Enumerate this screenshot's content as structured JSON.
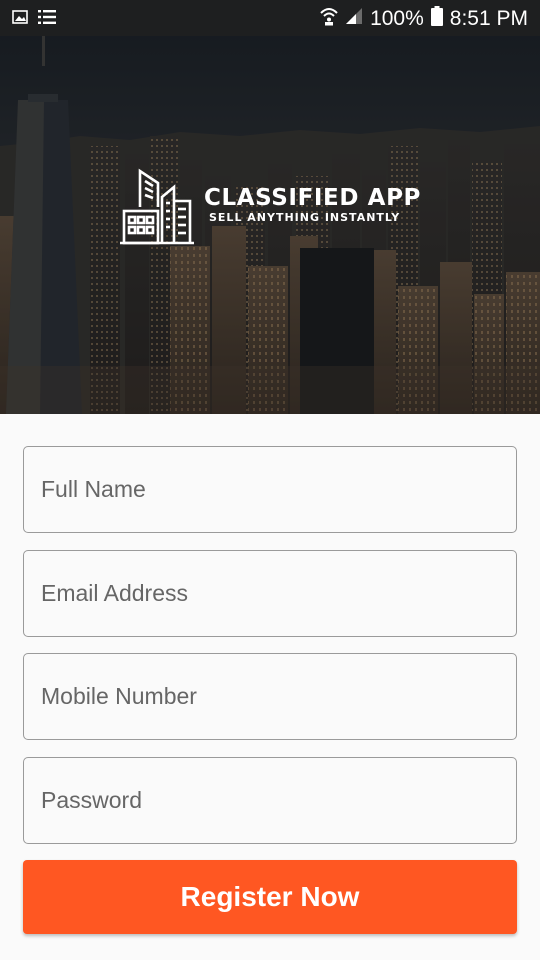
{
  "status_bar": {
    "icons_left": [
      "image-icon",
      "list-icon"
    ],
    "icons_right": [
      "wifi-icon",
      "signal-icon",
      "battery-icon"
    ],
    "battery": "100%",
    "time": "8:51 PM"
  },
  "hero": {
    "logo_icon": "city-buildings-icon",
    "app_name": "CLASSIFIED APP",
    "tagline": "SELL ANYTHING INSTANTLY"
  },
  "form": {
    "full_name_placeholder": "Full Name",
    "email_placeholder": "Email Address",
    "mobile_placeholder": "Mobile Number",
    "password_placeholder": "Password",
    "register_label": "Register Now"
  },
  "colors": {
    "accent": "#ff5722",
    "status_bar": "#1e1f20",
    "background": "#fafafa",
    "field_border": "#9a9a9a"
  }
}
